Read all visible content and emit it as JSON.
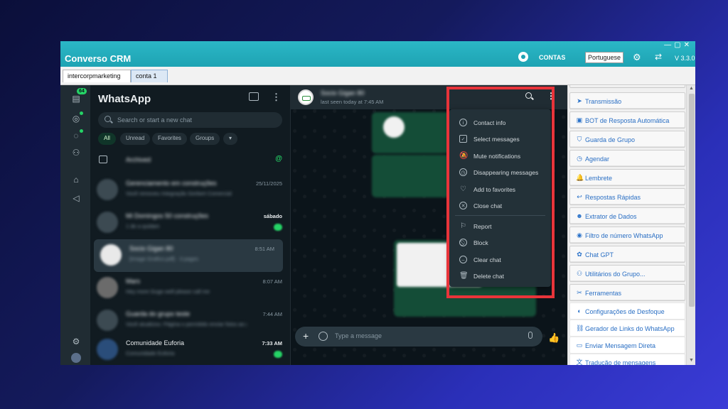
{
  "app": {
    "title": "Converso CRM",
    "contas_label": "CONTAS",
    "language_value": "Portuguese",
    "version": "V 3.3.0"
  },
  "tabs": [
    "intercorpmarketing",
    "conta 1"
  ],
  "rail": {
    "badge": "64"
  },
  "chatlist": {
    "title": "WhatsApp",
    "search_placeholder": "Search or start a new chat",
    "filters": [
      "All",
      "Unread",
      "Favorites",
      "Groups",
      "▾"
    ],
    "archived_label": "Archived",
    "archived_badge": "@",
    "rows": [
      {
        "name": "Gerenciamento em construções",
        "snippet": "Você removeu Integração Gerbert Comercial",
        "time": "25/11/2025"
      },
      {
        "name": "Mi Domingos 50 construções",
        "snippet": "1 de a quidam",
        "time": "sábado"
      },
      {
        "name": "Socio Gigan 80",
        "snippet": "[Image Grafico.pdf] · 3 pages",
        "time": "8:51 AM"
      },
      {
        "name": "Mars",
        "snippet": "Hey more Gugo well please call me",
        "time": "8:07 AM"
      },
      {
        "name": "Guarda do grupo teste",
        "snippet": "Você atualizou: Página o permitido enviar fotos ao grupo",
        "time": "7:44 AM"
      },
      {
        "name": "Comunidade Euforia",
        "snippet": "Comunidade Euforia",
        "time": "7:33 AM"
      }
    ]
  },
  "conversation": {
    "name": "Socio Gigan 80",
    "last_seen": "last seen today at 7:45 AM",
    "input_placeholder": "Type a message"
  },
  "context_menu": {
    "items": [
      "Contact info",
      "Select messages",
      "Mute notifications",
      "Disappearing messages",
      "Add to favorites",
      "Close chat"
    ],
    "danger_items": [
      "Report",
      "Block",
      "Clear chat",
      "Delete chat"
    ]
  },
  "panel": {
    "buttons": [
      "Transmissão",
      "BOT de Resposta Automática",
      "Guarda de Grupo",
      "Agendar",
      "Lembrete",
      "Respostas Rápidas",
      "Extrator de Dados",
      "Filtro de número WhatsApp",
      "Chat GPT",
      "Utilitários do Grupo...",
      "Ferramentas",
      "Configurações de Desfoque",
      "Gerador de Links do WhatsApp",
      "Enviar Mensagem Direta",
      "Tradução de mensagens"
    ]
  },
  "colors": {
    "titlebar": "#1ea3b3",
    "wa_bg": "#0b141a",
    "accent_green": "#25d366",
    "highlight_red": "#e8343a",
    "panel_link": "#2a6fc4"
  }
}
